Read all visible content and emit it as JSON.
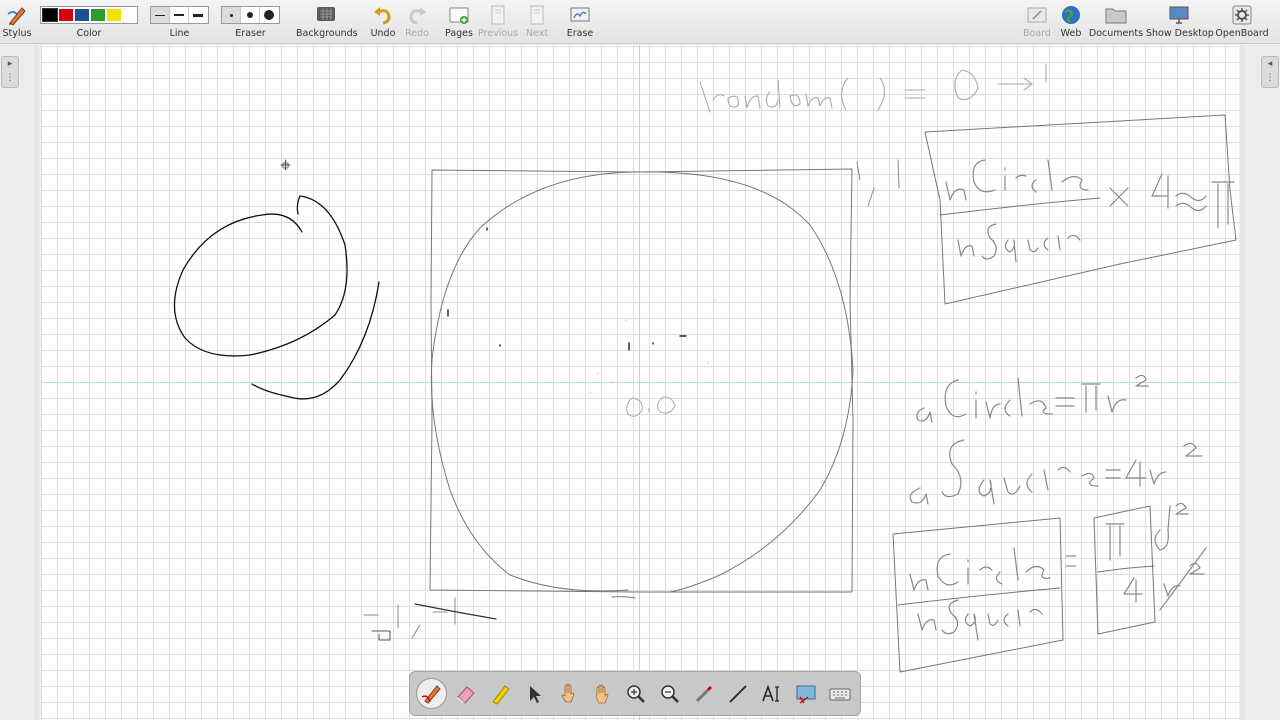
{
  "toolbar": {
    "stylus_label": "Stylus",
    "color_label": "Color",
    "line_label": "Line",
    "eraser_label": "Eraser",
    "backgrounds_label": "Backgrounds",
    "undo_label": "Undo",
    "redo_label": "Redo",
    "pages_label": "Pages",
    "previous_label": "Previous",
    "next_label": "Next",
    "erase_label": "Erase",
    "board_label": "Board",
    "web_label": "Web",
    "documents_label": "Documents",
    "show_desktop_label": "Show Desktop",
    "openboard_label": "OpenBoard"
  },
  "palette_colors": [
    "#000000",
    "#d8000f",
    "#1f4f8f",
    "#2c9a2c",
    "#f2e200"
  ],
  "selected_color": "#000000",
  "dock_tools": [
    "pen-tool-icon",
    "eraser-tool-icon",
    "highlighter-tool-icon",
    "select-tool-icon",
    "interact-tool-icon",
    "hand-tool-icon",
    "zoom-in-tool-icon",
    "zoom-out-tool-icon",
    "laser-pointer-tool-icon",
    "line-tool-icon",
    "text-tool-icon",
    "capture-tool-icon",
    "keyboard-tool-icon"
  ],
  "selected_dock_tool": "pen-tool-icon"
}
